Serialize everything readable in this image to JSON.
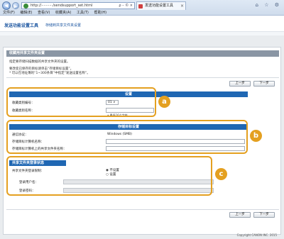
{
  "browser": {
    "url": "http://··········/sendsupport_set.html",
    "addr_tools": "ρ – © ×",
    "tab_title": "发送功能设置工具",
    "tab_close": "×",
    "window_icons": "⌂ ☆ ⚙",
    "menu": [
      "文件(F)",
      "编辑(E)",
      "查看(V)",
      "收藏夹(A)",
      "工具(T)",
      "帮助(H)"
    ]
  },
  "header": {
    "title": "发送功能设置工具",
    "subtitle": "存储到共享文件夹设置"
  },
  "panel": {
    "title": "收藏用共享文件夹设置",
    "desc_lines": [
      "指定要存储扫描数据的共享文件夹的设置。",
      "要改变已保存的目标请单击“存储目标设置”。",
      "* 可以在地址簿的“1~300条目”中指定“发送设置名称”。"
    ],
    "back_label": "上一步",
    "next_label": "下一步"
  },
  "sections": {
    "settings": {
      "header": "设置",
      "favorite_no_label": "收藏类别编号：",
      "favorite_no_value": "01 ∨",
      "favorite_name_label": "收藏类别名称：",
      "favorite_name_value": "",
      "favorite_name_note": "• 最多16个字符"
    },
    "destination": {
      "header": "存储目标设置",
      "protocol_label": "通信协议：",
      "protocol_value": "Windows (SMB)",
      "host_label": "存储目标计算机名称：",
      "host_value": "",
      "folder_label": "存储目标计算机上的共享文件夹名称：",
      "folder_value": ""
    },
    "login": {
      "header": "共享文件夹登录状态",
      "login_label": "共享文件夹登录限制：",
      "option_none": "不设置",
      "option_set": "设置",
      "selected": "不设置",
      "user_label": "登录用户名：",
      "password_label": "登录密码："
    }
  },
  "callouts": [
    "a",
    "b",
    "c"
  ],
  "colors": {
    "callout": "#e4a020",
    "section_header": "#1f67b3"
  },
  "footer": {
    "copyright": "Copyright CANON INC. 2015"
  }
}
